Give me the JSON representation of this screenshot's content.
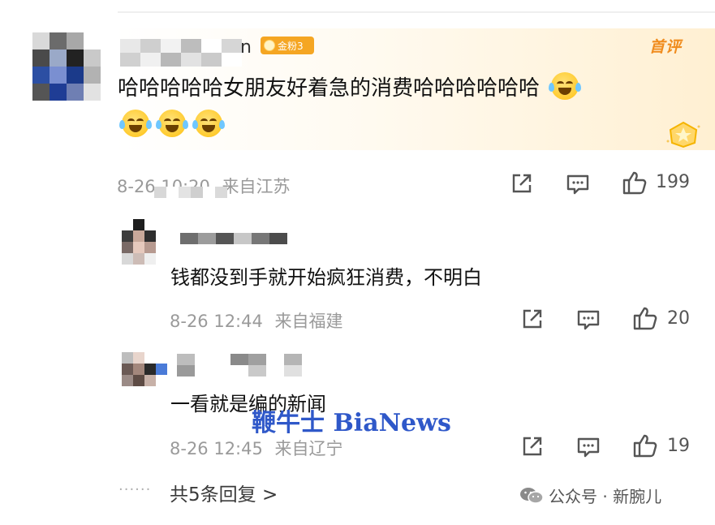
{
  "comment": {
    "username_tail": "n",
    "badge_label": "金粉3",
    "first_comment_tag": "首评",
    "text": "哈哈哈哈哈女朋友好着急的消费哈哈哈哈哈哈",
    "emoji_names": [
      "laugh-cry",
      "laugh-cry",
      "laugh-cry",
      "laugh-cry"
    ],
    "timestamp": "8-26 10:20",
    "location": "来自江苏",
    "likes": "199"
  },
  "replies": [
    {
      "text": "钱都没到手就开始疯狂消费，不明白",
      "timestamp": "8-26 12:44",
      "location": "来自福建",
      "likes": "20"
    },
    {
      "text": "一看就是编的新闻",
      "timestamp": "8-26 12:45",
      "location": "来自辽宁",
      "likes": "19"
    }
  ],
  "more": {
    "dots": "······",
    "label": "共5条回复 >"
  },
  "watermark": "鞭牛士 BiaNews",
  "official": {
    "icon": "wechat-icon",
    "label": "公众号 · 新腕儿"
  },
  "colors": {
    "badge": "#f5a623",
    "first_comment": "#f08c1e",
    "watermark": "#2f58c9",
    "meta": "#9a9a9a"
  }
}
